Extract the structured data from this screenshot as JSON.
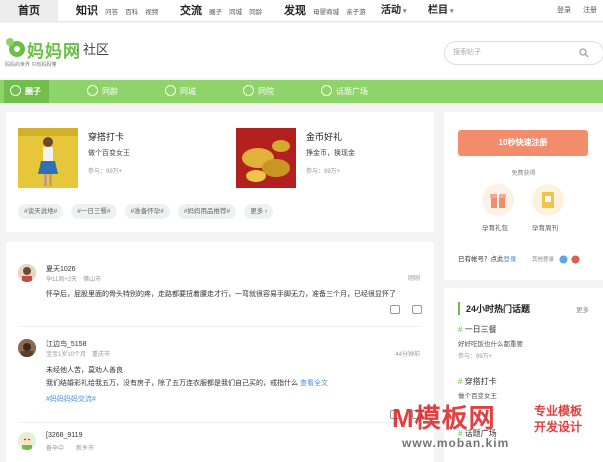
{
  "topnav": {
    "home": "首页",
    "groups": [
      {
        "title": "知识",
        "subs": [
          "问答",
          "百科",
          "视频"
        ]
      },
      {
        "title": "交流",
        "subs": [
          "圈子",
          "同城",
          "同龄"
        ]
      },
      {
        "title": "发现",
        "subs": [
          "母婴商城",
          "亲子游"
        ]
      }
    ],
    "activity": "活动",
    "column": "栏目",
    "login": "登录",
    "register": "注册"
  },
  "header": {
    "logo_text": "妈妈网",
    "site_section": "· 社区",
    "logo_slogan": "妈妈的世界 只有妈妈懂",
    "search_placeholder": "搜索帖子"
  },
  "green_tabs": [
    "圈子",
    "同龄",
    "同城",
    "同院",
    "话题广场"
  ],
  "featured": [
    {
      "title": "穿搭打卡",
      "desc": "做个百变女王",
      "meta": "参与：99万+"
    },
    {
      "title": "金币好礼",
      "desc": "挣金币，换现金",
      "meta": "参与：99万+"
    }
  ],
  "tags": [
    "#谈天说地#",
    "#一日三餐#",
    "#准备怀孕#",
    "#妈妈用品推荐#",
    "更多 ›"
  ],
  "posts": [
    {
      "name": "夏天1026",
      "sub": "孕11周+2天　佛山市",
      "right": "刚刚",
      "body": "怀孕后，屁股里面的骨头特别的疼，走路都要扭着腰走才行，一弯就很容易手脚无力，准备三个月，已经很显怀了",
      "more": "",
      "tag": ""
    },
    {
      "name": "江边鸟_5158",
      "sub": "宝宝1岁10个月　重庆市",
      "right": "44分钟前",
      "body": "未经他人苦，莫劝人善良",
      "body2": "我们结婚彩礼给我五万，没有房子，除了五万连衣服都是我们自己买的，戒指什么",
      "more": "查看全文",
      "tag": "#妈妈妈妈交流#"
    },
    {
      "name": "[3268_9119",
      "sub": "备孕中　　新乡市",
      "right": "",
      "body": "",
      "more": "",
      "tag": ""
    }
  ],
  "register_card": {
    "button": "10秒快速注册",
    "free_label": "免费获得",
    "gifts": [
      "孕育礼包",
      "孕育周刊"
    ],
    "have_account": "已有帐号？点此",
    "login_link": "登录",
    "other_login": "其他登录"
  },
  "hot": {
    "title": "24小时热门话题",
    "more": "更多",
    "items": [
      {
        "topic": "一日三餐",
        "desc": "好好吃饭也什么都重要",
        "meta": "参与：99万+"
      },
      {
        "topic": "穿搭打卡",
        "desc": "做个百变女王",
        "meta": ""
      },
      {
        "topic": "话题广场",
        "desc": "",
        "meta": ""
      }
    ]
  },
  "watermark": {
    "main": "M模板网",
    "side1": "专业模板",
    "side2": "开发设计",
    "url": "www.moban.kim"
  },
  "colors": {
    "brand_green": "#6abf44",
    "nav_green": "#8fd36b",
    "register": "#f28c6b",
    "link": "#4a90d9"
  }
}
